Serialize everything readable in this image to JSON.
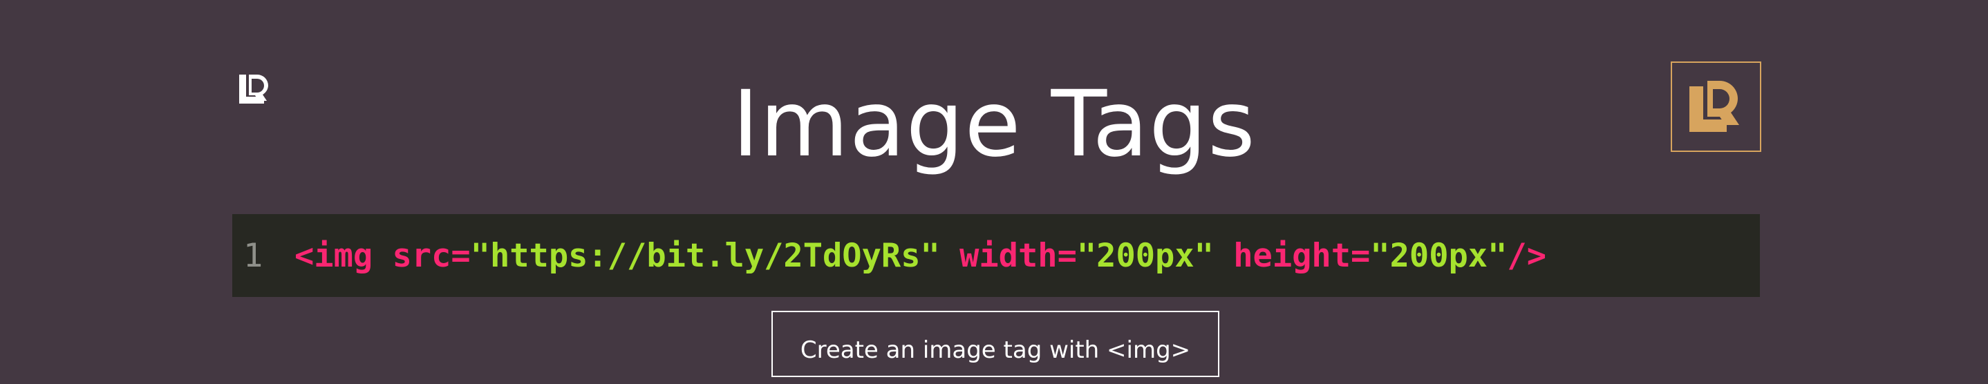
{
  "header": {
    "title": "Image Tags",
    "small_logo_icon": "codecademy-logo-icon",
    "boxed_logo_icon": "codecademy-logo-icon",
    "accent_color": "#d7a45e"
  },
  "code": {
    "line_number": "1",
    "tokens": {
      "open": "<img",
      "src_attr": "src",
      "eq1": "=",
      "src_value": "\"https://bit.ly/2TdOyRs\"",
      "width_attr": "width",
      "eq2": "=",
      "width_value": "\"200px\"",
      "height_attr": "height",
      "eq3": "=",
      "height_value": "\"200px\"",
      "close": "/>"
    },
    "colors": {
      "background": "#272822",
      "tag": "#f92672",
      "string": "#a6e22e",
      "line_number": "#8f908a"
    }
  },
  "step": {
    "label": "Create an image tag with <img>"
  }
}
